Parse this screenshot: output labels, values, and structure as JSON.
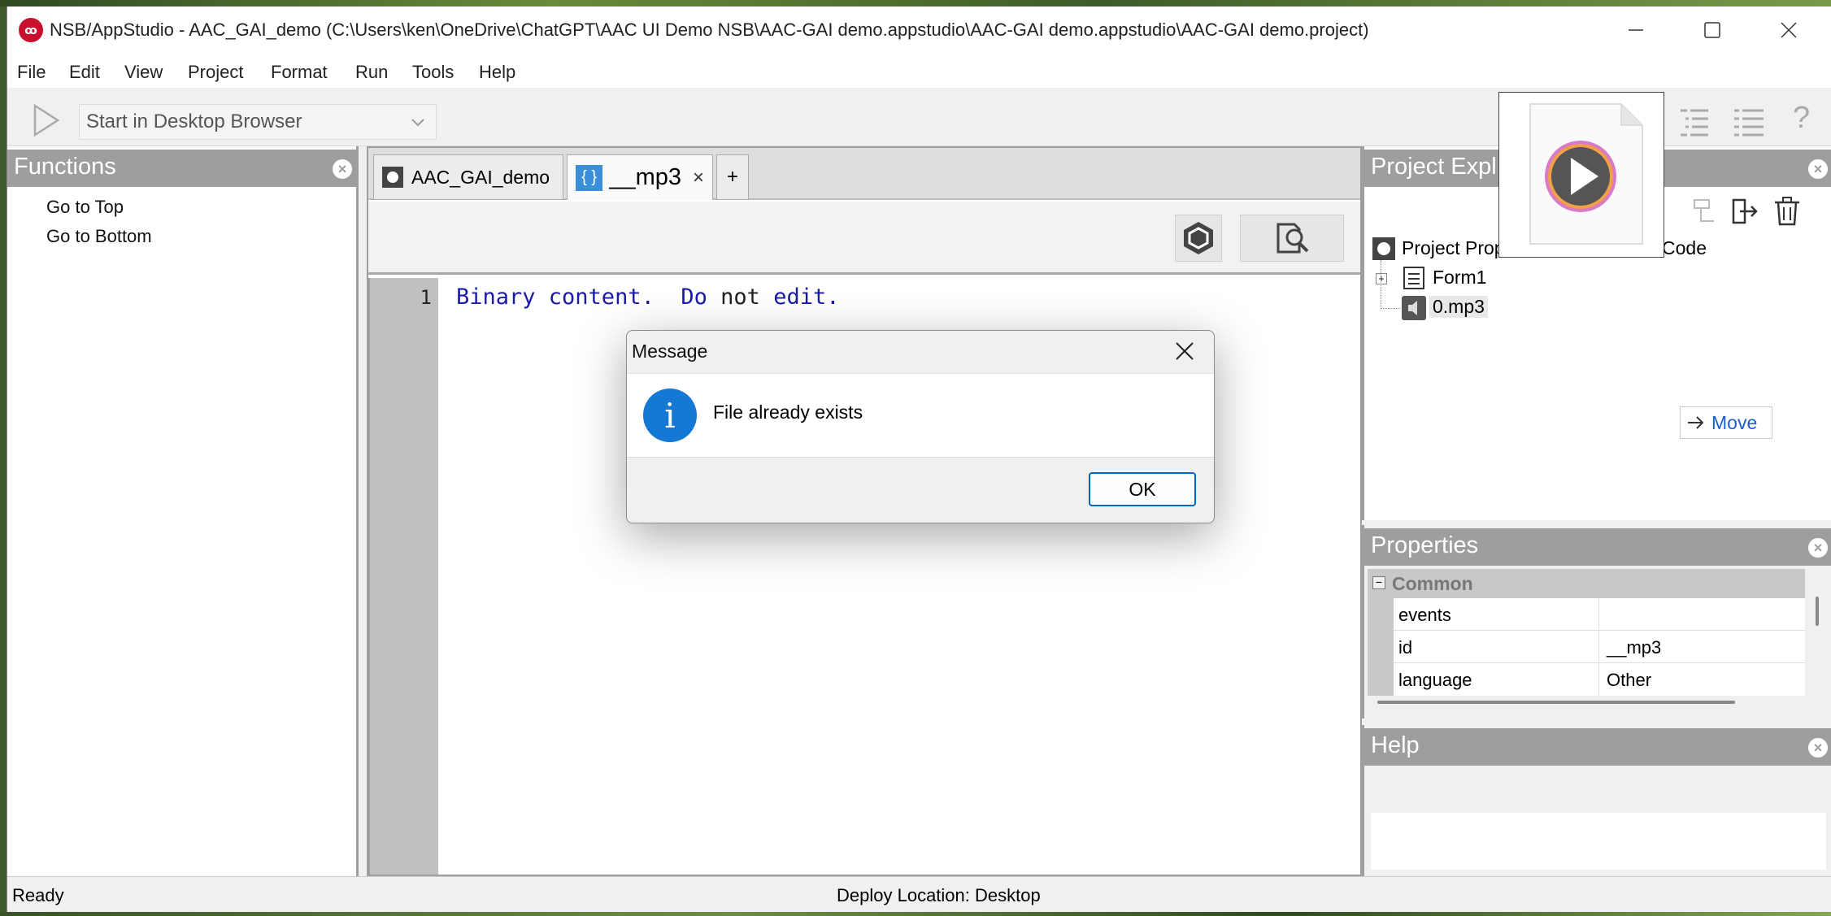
{
  "window": {
    "title": "NSB/AppStudio - AAC_GAI_demo (C:\\Users\\ken\\OneDrive\\ChatGPT\\AAC UI Demo NSB\\AAC-GAI demo.appstudio\\AAC-GAI demo.appstudio\\AAC-GAI demo.project)",
    "app_icon_text": "ꝏ"
  },
  "menubar": {
    "items": [
      "File",
      "Edit",
      "View",
      "Project",
      "Format",
      "Run",
      "Tools",
      "Help"
    ]
  },
  "toolbar": {
    "deploy_target": "Start in Desktop Browser",
    "help_glyph": "?"
  },
  "functions_panel": {
    "title": "Functions",
    "items": [
      "Go to Top",
      "Go to Bottom"
    ]
  },
  "editor": {
    "tabs": [
      {
        "label": "AAC_GAI_demo",
        "active": false
      },
      {
        "label": "__mp3",
        "icon_text": "{ }",
        "close_glyph": "×",
        "active": true
      }
    ],
    "add_tab_label": "+",
    "line_numbers": [
      "1"
    ],
    "code_lines": [
      {
        "parts": [
          "Binary content.",
          "Do",
          "not",
          "edit."
        ]
      }
    ]
  },
  "project_explorer": {
    "title": "Project Expl",
    "tree": [
      {
        "label": "Project Prop",
        "suffix": "Code"
      },
      {
        "label": "Form1"
      },
      {
        "label": "0.mp3"
      }
    ],
    "move_button": "Move"
  },
  "properties": {
    "title": "Properties",
    "group": "Common",
    "rows": [
      {
        "name": "events",
        "value": ""
      },
      {
        "name": "id",
        "value": "__mp3"
      },
      {
        "name": "language",
        "value": "Other"
      }
    ]
  },
  "help_panel": {
    "title": "Help"
  },
  "statusbar": {
    "left": "Ready",
    "center": "Deploy Location: Desktop"
  },
  "dialog": {
    "title": "Message",
    "message": "File already exists",
    "info_glyph": "i",
    "ok_label": "OK"
  },
  "colors": {
    "accent": "#0067c0",
    "panel_header": "#9e9e9e",
    "code_text": "#1a1aa6",
    "info_icon": "#1479d4"
  }
}
